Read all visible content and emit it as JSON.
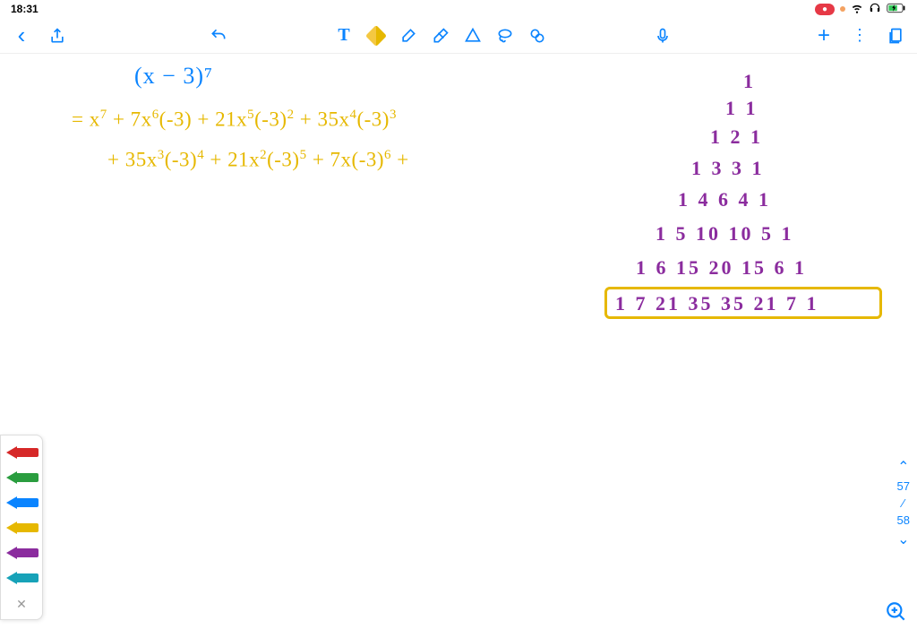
{
  "status": {
    "time": "18:31",
    "recording": "●",
    "wifi": "wifi",
    "headphones": "hp",
    "battery": "bat"
  },
  "toolbar": {
    "back": "‹",
    "share": "share",
    "undo": "undo",
    "text_tool": "T",
    "pen": "pen",
    "highlighter": "hl",
    "eraser": "er",
    "shape": "sh",
    "lasso": "lasso",
    "ruler": "ruler",
    "mic": "mic",
    "add": "+",
    "more": "⋮",
    "pages": "pg"
  },
  "handwriting": {
    "expr_title": "(x − 3)⁷",
    "line1": "= x⁷ + 7x⁶(-3) + 21x⁵(-3)² + 35x⁴(-3)³",
    "line2": "+ 35x³(-3)⁴ + 21x²(-3)⁵ + 7x(-3)⁶ +"
  },
  "pascal": {
    "r0": "1",
    "r1": "1   1",
    "r2": "1   2   1",
    "r3": "1   3   3   1",
    "r4": "1  4  6  4  1",
    "r5": "1  5  10  10  5  1",
    "r6": "1  6  15  20  15  6  1",
    "r7": "1  7  21  35  35  21  7  1"
  },
  "pens": [
    {
      "color": "#d62828"
    },
    {
      "color": "#2a9d3f"
    },
    {
      "color": "#0a84ff"
    },
    {
      "color": "#e6b800"
    },
    {
      "color": "#8b2c9e"
    },
    {
      "color": "#17a2b8"
    }
  ],
  "page_nav": {
    "up": "⌃",
    "current": "57",
    "sep": "⁄",
    "total": "58",
    "down": "⌄"
  },
  "zoom": "⊕"
}
